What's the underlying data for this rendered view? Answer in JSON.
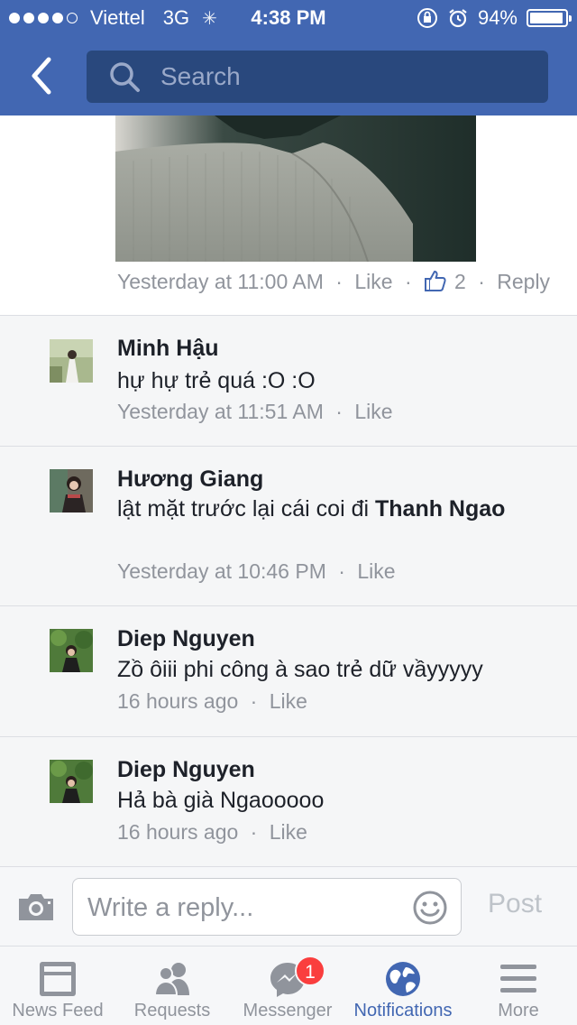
{
  "status_bar": {
    "carrier": "Viettel",
    "network": "3G",
    "time": "4:38 PM",
    "battery_text": "94%",
    "battery_level": 0.94
  },
  "nav": {
    "search_placeholder": "Search"
  },
  "post_footer": {
    "timestamp": "Yesterday at 11:00 AM",
    "like_label": "Like",
    "like_count": "2",
    "reply_label": "Reply"
  },
  "comments": [
    {
      "name": "Minh Hậu",
      "text": "hự hự trẻ quá :O :O",
      "mention": "",
      "timestamp": "Yesterday at 11:51 AM",
      "like_label": "Like"
    },
    {
      "name": "Hương Giang",
      "text": "lật mặt trước lại cái coi đi",
      "mention": "Thanh Ngao",
      "timestamp": "Yesterday at 10:46 PM",
      "like_label": "Like"
    },
    {
      "name": "Diep Nguyen",
      "text": "Zồ ôiii phi công à sao trẻ dữ vầyyyyy",
      "mention": "",
      "timestamp": "16 hours ago",
      "like_label": "Like"
    },
    {
      "name": "Diep Nguyen",
      "text": "Hả bà già Ngaooooo",
      "mention": "",
      "timestamp": "16 hours ago",
      "like_label": "Like"
    }
  ],
  "reply_bar": {
    "placeholder": "Write a reply...",
    "post_label": "Post"
  },
  "tabs": [
    {
      "label": "News Feed",
      "icon": "news-feed-icon",
      "active": false
    },
    {
      "label": "Requests",
      "icon": "friend-requests-icon",
      "active": false
    },
    {
      "label": "Messenger",
      "icon": "messenger-icon",
      "active": false,
      "badge": "1"
    },
    {
      "label": "Notifications",
      "icon": "globe-icon",
      "active": true
    },
    {
      "label": "More",
      "icon": "menu-icon",
      "active": false
    }
  ],
  "colors": {
    "brand": "#4267b2",
    "search_bg": "#29487d",
    "badge": "#fa3e3e",
    "meta_text": "#90949c"
  }
}
